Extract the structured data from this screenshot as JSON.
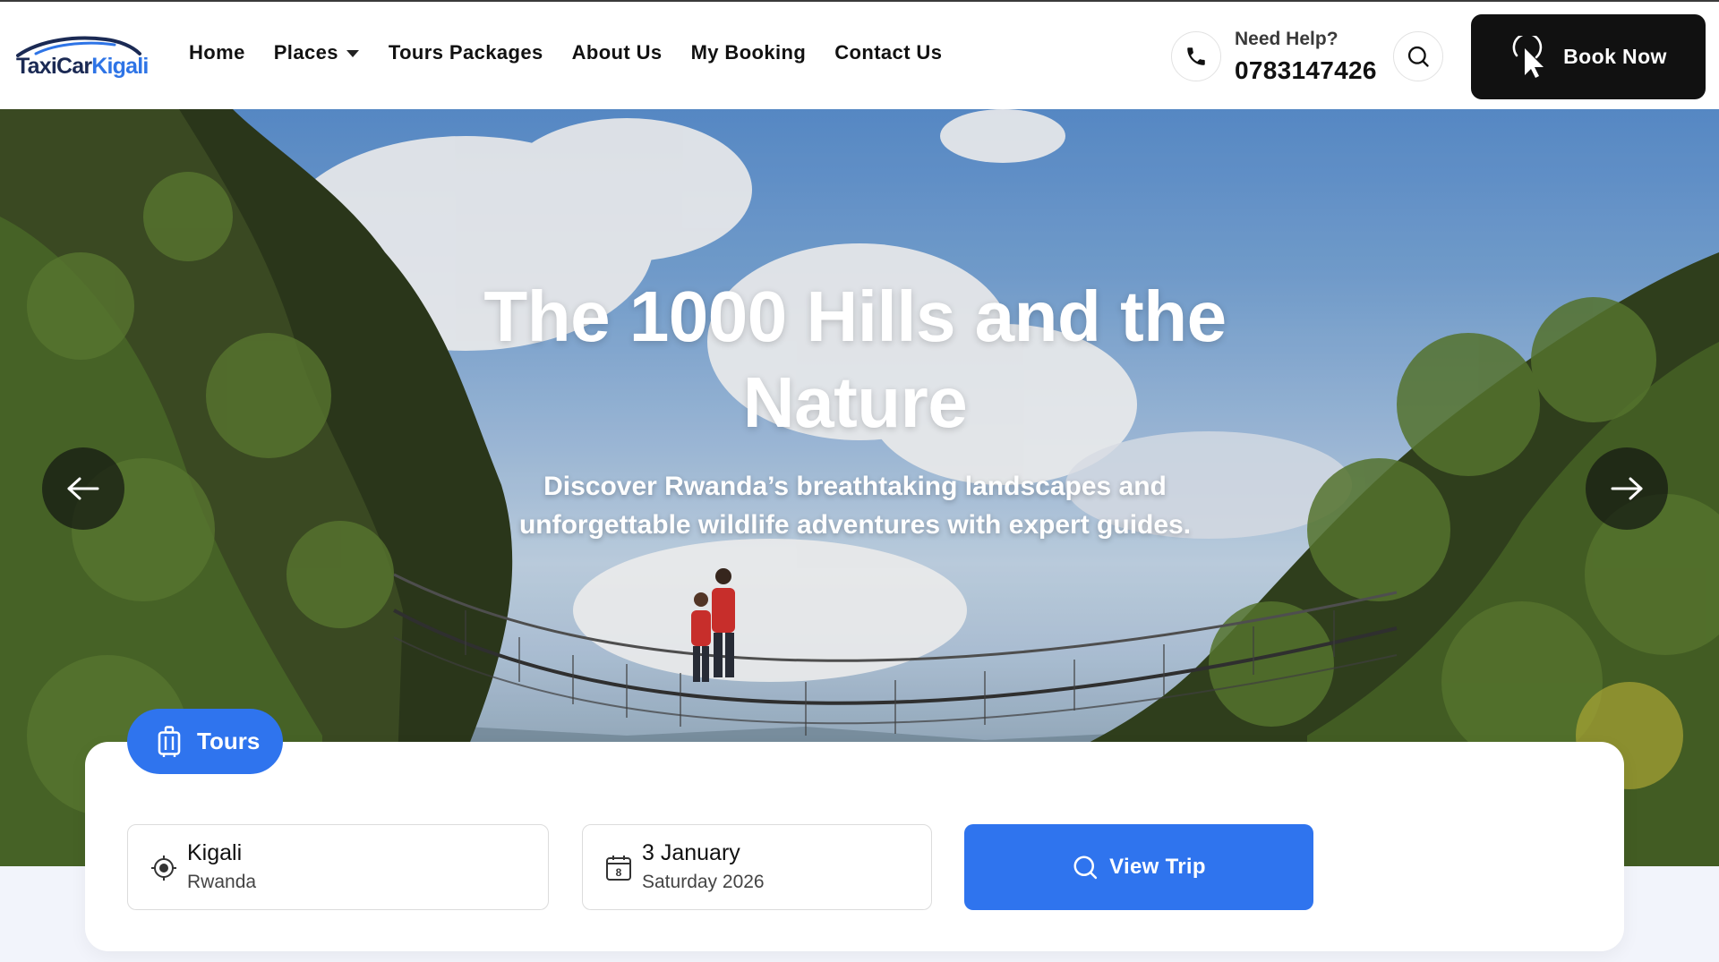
{
  "brand": {
    "name_part1": "TaxiCar",
    "name_part2": "Kigali"
  },
  "nav": {
    "items": [
      {
        "label": "Home"
      },
      {
        "label": "Places"
      },
      {
        "label": "Tours Packages"
      },
      {
        "label": "About Us"
      },
      {
        "label": "My Booking"
      },
      {
        "label": "Contact Us"
      }
    ]
  },
  "help": {
    "label": "Need Help?",
    "phone": "0783147426"
  },
  "book_button": {
    "label": "Book Now"
  },
  "hero": {
    "title": "The 1000 Hills and the Nature",
    "subtitle": "Discover Rwanda’s breathtaking landscapes and unforgettable wildlife adventures with expert guides."
  },
  "search": {
    "tab_label": "Tours",
    "location": {
      "city": "Kigali",
      "country": "Rwanda"
    },
    "date": {
      "day_month": "3 January",
      "weekday_year": "Saturday 2026",
      "calendar_number": "8"
    },
    "submit_label": "View Trip"
  },
  "colors": {
    "accent": "#2f74ee",
    "dark": "#111111",
    "logo_navy": "#1b2a54",
    "logo_blue": "#2e74e6"
  },
  "icons": [
    "car-logo-icon",
    "caret-down-icon",
    "phone-icon",
    "search-icon",
    "pointer-icon",
    "arrow-left-icon",
    "arrow-right-icon",
    "luggage-icon",
    "location-target-icon",
    "calendar-icon"
  ]
}
